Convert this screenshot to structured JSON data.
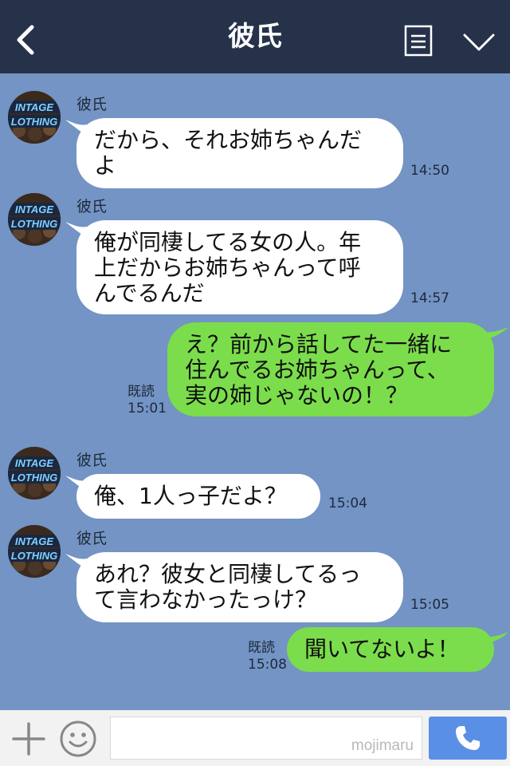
{
  "header": {
    "title": "彼氏",
    "back_icon": "chevron-left-icon",
    "menu_icon": "list-icon",
    "expand_icon": "chevron-down-icon"
  },
  "avatar": {
    "text_line1": "INTAGE",
    "text_line2": "LOTHING"
  },
  "messages": [
    {
      "sender": "彼氏",
      "text": "だから、それお姉ちゃんだ\nよ",
      "time": "14:50"
    },
    {
      "sender": "彼氏",
      "text": "俺が同棲してる女の人。年\n上だからお姉ちゃんって呼\nんでるんだ",
      "time": "14:57"
    },
    {
      "text": "え？前から話してた一緒に\n住んでるお姉ちゃんって、\n実の姉じゃないの！？",
      "read": "既読",
      "time": "15:01"
    },
    {
      "sender": "彼氏",
      "text": "俺、1人っ子だよ？",
      "time": "15:04"
    },
    {
      "sender": "彼氏",
      "text": "あれ？彼女と同棲してるっ\nて言わなかったっけ？",
      "time": "15:05"
    },
    {
      "text": "聞いてないよ！",
      "read": "既読",
      "time": "15:08"
    }
  ],
  "footer": {
    "add_icon": "plus-icon",
    "sticker_icon": "smile-icon",
    "watermark": "mojimaru",
    "call_icon": "phone-icon"
  },
  "colors": {
    "header_bg": "#26324a",
    "chat_bg": "#7394c4",
    "incoming_bubble": "#ffffff",
    "outgoing_bubble": "#7bdd4b",
    "send_button": "#5a8fe6"
  }
}
